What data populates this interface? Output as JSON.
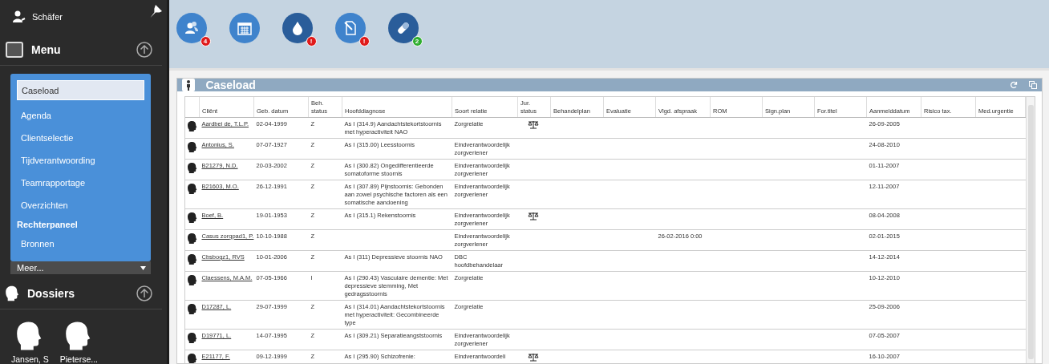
{
  "sidebar": {
    "user": "Schäfer",
    "menu": {
      "title": "Menu",
      "items": [
        {
          "label": "Caseload",
          "kind": "item",
          "selected": true
        },
        {
          "label": "Agenda",
          "kind": "item",
          "selected": false
        },
        {
          "label": "Clientselectie",
          "kind": "item",
          "selected": false
        },
        {
          "label": "Tijdverantwoording",
          "kind": "item",
          "selected": false
        },
        {
          "label": "Teamrapportage",
          "kind": "item",
          "selected": false
        },
        {
          "label": "Overzichten",
          "kind": "item",
          "selected": false
        },
        {
          "label": "Rechterpaneel",
          "kind": "header",
          "selected": false
        },
        {
          "label": "Bronnen",
          "kind": "item",
          "selected": false
        }
      ],
      "more": "Meer..."
    },
    "dossiers": {
      "title": "Dossiers",
      "items": [
        "Jansen, S",
        "Pieterse..."
      ]
    }
  },
  "toolbar": [
    {
      "kind": "people",
      "badge": "4",
      "color": "#e01b1b"
    },
    {
      "kind": "calendar"
    },
    {
      "kind": "drop",
      "badge": "!",
      "color": "#e01b1b"
    },
    {
      "kind": "document",
      "badge": "!",
      "color": "#e01b1b"
    },
    {
      "kind": "pill",
      "badge": "2",
      "color": "#2fae2f"
    }
  ],
  "panel": {
    "title": "Caseload",
    "table": {
      "columns": [
        "Cliënt",
        "Geb. datum",
        "Beh. status",
        "Hoofddiagnose",
        "Soort relatie",
        "Jur. status",
        "Behandelplan",
        "Evaluatie",
        "Vlgd. afspraak",
        "ROM",
        "Sign.plan",
        "For.titel",
        "Aanmelddatum",
        "Risico tax.",
        "Med.urgentie"
      ],
      "rows": [
        {
          "client": "Aardbei de, T.L.P.",
          "birth": "02-04-1999",
          "status": "Z",
          "diagnosis": "As I (314.9) Aandachtstekortstoornis met hyperactiviteit NAO",
          "relation": "Zorgrelatie",
          "jur_status": true,
          "appointment": "",
          "registered": "26-09-2005"
        },
        {
          "client": "Antonius, S.",
          "birth": "07-07-1927",
          "status": "Z",
          "diagnosis": "As I (315.00) Leesstoornis",
          "relation": "Eindverantwoordelijk zorgverlener",
          "jur_status": false,
          "appointment": "",
          "registered": "24-08-2010"
        },
        {
          "client": "B21279, N.D.",
          "birth": "20-03-2002",
          "status": "Z",
          "diagnosis": "As I (300.82) Ongedifferentieerde somatoforme stoornis",
          "relation": "Eindverantwoordelijk zorgverlener",
          "jur_status": false,
          "appointment": "",
          "registered": "01-11-2007"
        },
        {
          "client": "B21603, M.O.",
          "birth": "26-12-1991",
          "status": "Z",
          "diagnosis": "As I (307.89) Pijnstoornis: Gebonden aan zowel psychische factoren als een somatische aandoening",
          "relation": "Eindverantwoordelijk zorgverlener",
          "jur_status": false,
          "appointment": "",
          "registered": "12-11-2007"
        },
        {
          "client": "Boef, B.",
          "birth": "19-01-1953",
          "status": "Z",
          "diagnosis": "As I (315.1) Rekenstoornis",
          "relation": "Eindverantwoordelijk zorgverlener",
          "jur_status": true,
          "appointment": "",
          "registered": "08-04-2008"
        },
        {
          "client": "Casus zorgpad1, P.",
          "birth": "10-10-1988",
          "status": "Z",
          "diagnosis": "",
          "relation": "Eindverantwoordelijk zorgverlener",
          "jur_status": false,
          "appointment": "26-02-2016 0:00",
          "registered": "02-01-2015"
        },
        {
          "client": "Cbsbogz1, RVS",
          "birth": "10-01-2006",
          "status": "Z",
          "diagnosis": "As I (311) Depressieve stoornis NAO",
          "relation": "DBC hoofdbehandelaar",
          "jur_status": false,
          "appointment": "",
          "registered": "14-12-2014"
        },
        {
          "client": "Claessens, M.A.M.",
          "birth": "07-05-1966",
          "status": "I",
          "diagnosis": "As I (290.43) Vasculaire dementie: Met depressieve stemming, Met gedragsstoornis",
          "relation": "Zorgrelatie",
          "jur_status": false,
          "appointment": "",
          "registered": "10-12-2010"
        },
        {
          "client": "D17287, L.",
          "birth": "29-07-1999",
          "status": "Z",
          "diagnosis": "As I (314.01) Aandachtstekortstoornis met hyperactiviteit: Gecombineerde type",
          "relation": "Zorgrelatie",
          "jur_status": false,
          "appointment": "",
          "registered": "25-09-2006"
        },
        {
          "client": "D19771, L.",
          "birth": "14-07-1995",
          "status": "Z",
          "diagnosis": "As I (309.21) Separatieangststoornis",
          "relation": "Eindverantwoordelijk zorgverlener",
          "jur_status": false,
          "appointment": "",
          "registered": "07-05-2007"
        },
        {
          "client": "E21177, F.",
          "birth": "09-12-1999",
          "status": "Z",
          "diagnosis": "As I (295.90) Schizofrenie:",
          "relation": "Eindverantwoordeli",
          "jur_status": true,
          "appointment": "",
          "registered": "16-10-2007"
        }
      ]
    }
  }
}
